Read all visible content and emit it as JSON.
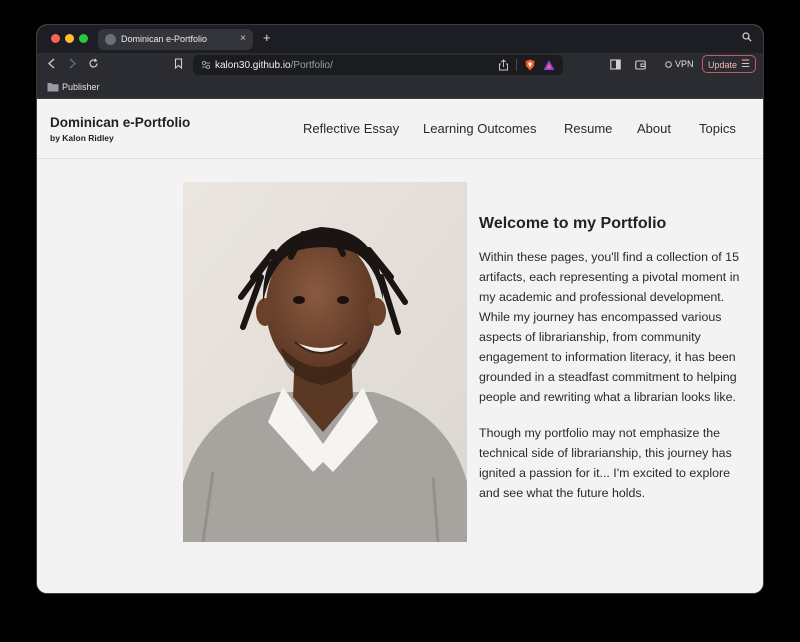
{
  "browser": {
    "tab_title": "Dominican e-Portfolio",
    "tab_close": "×",
    "new_tab": "+",
    "url_host": "kalon30.github.io",
    "url_path": "/Portfolio/",
    "vpn_label": "VPN",
    "update_label": "Update",
    "menu_glyph": "☰",
    "bookmark_label": "Publisher",
    "icons": [
      "back-icon",
      "forward-icon",
      "reload-icon",
      "bookmark-icon",
      "share-icon",
      "brave-shields-icon",
      "brave-rewards-icon",
      "sidebar-icon",
      "wallet-icon",
      "vpn-icon",
      "search-tabs-icon",
      "folder-icon",
      "globe-icon"
    ]
  },
  "site": {
    "title": "Dominican e-Portfolio",
    "byline": "by Kalon Ridley",
    "nav": [
      "Reflective Essay",
      "Learning Outcomes",
      "Resume",
      "About",
      "Topics"
    ]
  },
  "main": {
    "heading": "Welcome to my Portfolio",
    "paragraphs": [
      "Within these pages, you'll find a collection of 15 artifacts, each representing a pivotal moment in my academic and professional development. While my journey has encompassed various aspects of librarianship, from community engagement to information literacy, it has been grounded in a steadfast commitment to helping people and rewriting what a librarian looks like.",
      "Though my portfolio may not emphasize the technical side of librarianship, this journey has ignited a passion for it... I'm excited to explore and see what the future holds."
    ]
  },
  "colors": {
    "page_bg": "#f3f3f3",
    "chrome_bg": "#2b2c31",
    "tabbar_bg": "#1d1e23",
    "update_accent": "#b9615d",
    "text": "#222222"
  }
}
